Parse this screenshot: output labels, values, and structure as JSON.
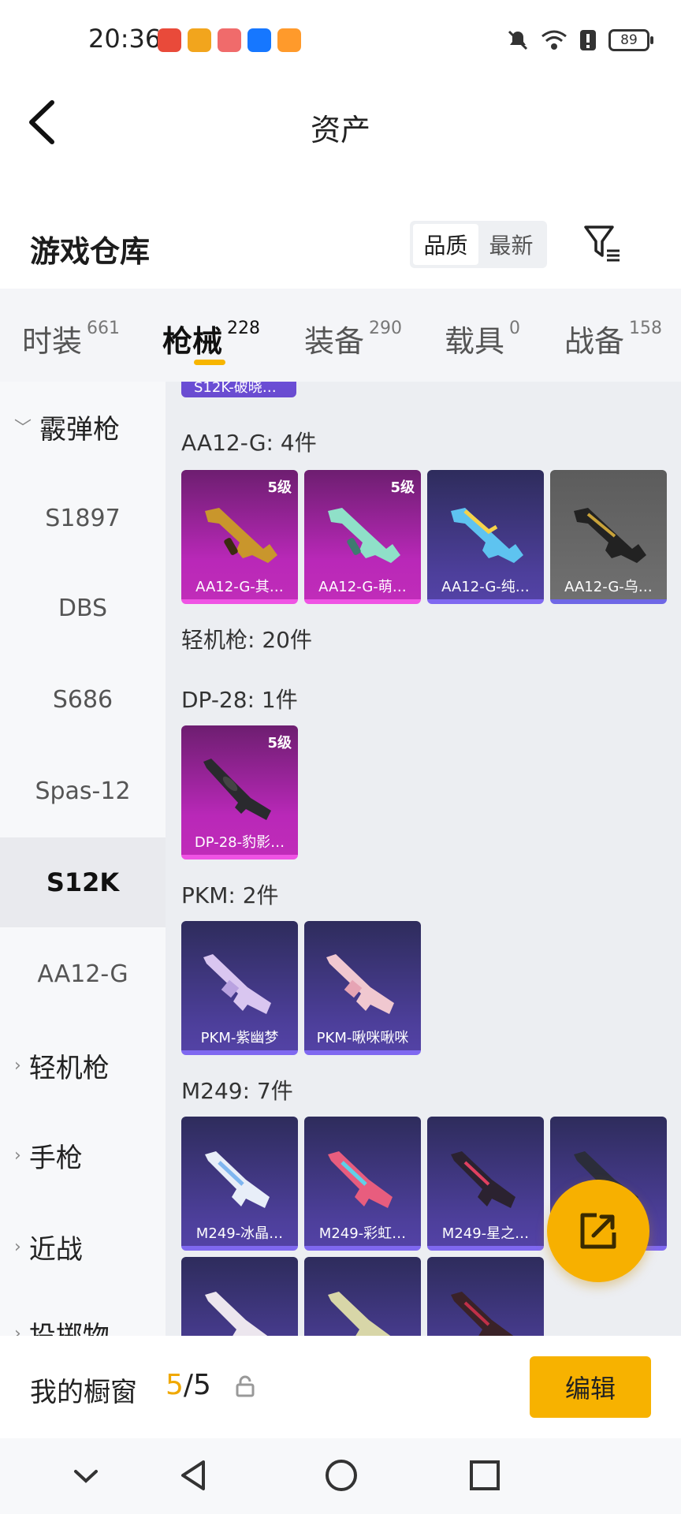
{
  "status_bar": {
    "time": "20:36",
    "battery": "89",
    "app_icon_colors": [
      "#e94a3a",
      "#f2a51d",
      "#f06b6b",
      "#1677ff",
      "#ff9a2b"
    ]
  },
  "header": {
    "title": "资产"
  },
  "warehouse": {
    "title": "游戏仓库",
    "sort_options": [
      "品质",
      "最新"
    ],
    "sort_active": "品质"
  },
  "tabs": [
    {
      "label": "时装",
      "count": "661"
    },
    {
      "label": "枪械",
      "count": "228"
    },
    {
      "label": "装备",
      "count": "290"
    },
    {
      "label": "载具",
      "count": "0"
    },
    {
      "label": "战备",
      "count": "158"
    }
  ],
  "sidebar": {
    "group_shotgun": "霰弹枪",
    "items": [
      "S1897",
      "DBS",
      "S686",
      "Spas-12",
      "S12K",
      "AA12-G"
    ],
    "selected": "S12K",
    "group_lmg": "轻机枪",
    "group_pistol": "手枪",
    "group_melee": "近战",
    "group_throw": "投掷物"
  },
  "content": {
    "cut_card_name": "S12K-破晓…",
    "aa12": {
      "title": "AA12-G: 4件",
      "cards": [
        {
          "name": "AA12-G-其…",
          "level": "5级",
          "tier": "pink"
        },
        {
          "name": "AA12-G-萌…",
          "level": "5级",
          "tier": "pink"
        },
        {
          "name": "AA12-G-纯…",
          "level": "",
          "tier": "purple"
        },
        {
          "name": "AA12-G-乌…",
          "level": "",
          "tier": "grey"
        }
      ]
    },
    "lmg_title": "轻机枪: 20件",
    "dp28": {
      "title": "DP-28: 1件",
      "cards": [
        {
          "name": "DP-28-豹影…",
          "level": "5级",
          "tier": "pink"
        }
      ]
    },
    "pkm": {
      "title": "PKM: 2件",
      "cards": [
        {
          "name": "PKM-紫幽梦",
          "tier": "purple"
        },
        {
          "name": "PKM-啾咪啾咪",
          "tier": "purple"
        }
      ]
    },
    "m249": {
      "title": "M249: 7件",
      "cards": [
        {
          "name": "M249-冰晶…",
          "tier": "purple"
        },
        {
          "name": "M249-彩虹…",
          "tier": "purple"
        },
        {
          "name": "M249-星之…",
          "tier": "purple"
        },
        {
          "name": "",
          "tier": "purple"
        }
      ]
    }
  },
  "showcase": {
    "label": "我的橱窗",
    "count_current": "5",
    "count_total": "/5",
    "edit_label": "编辑"
  },
  "colors": {
    "accent": "#f7b200",
    "epic_pink": "#c02cb9",
    "rare_purple": "#4d3f9b"
  }
}
